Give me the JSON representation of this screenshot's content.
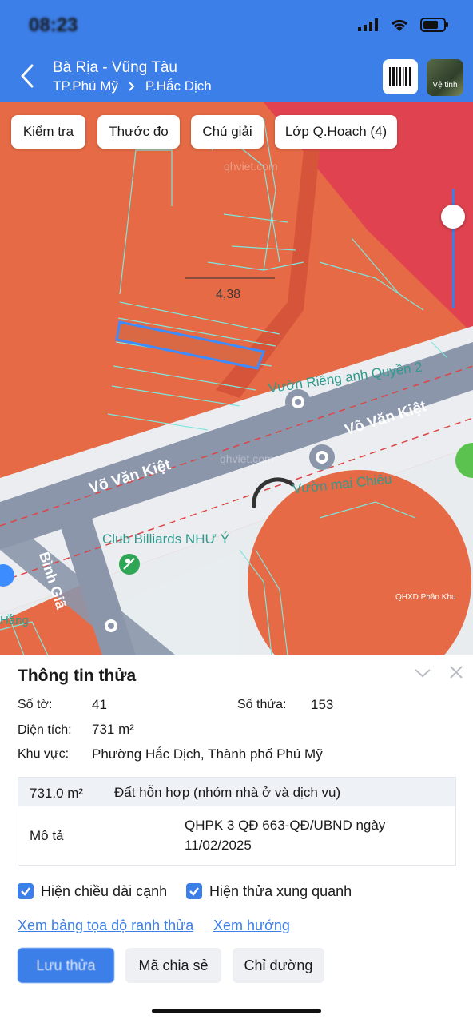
{
  "status_bar": {
    "time": "08:23"
  },
  "header": {
    "title": "Bà Rịa - Vũng Tàu",
    "breadcrumb": [
      "TP.Phú Mỹ",
      "P.Hắc Dịch"
    ],
    "satellite_label": "Vệ tinh"
  },
  "toolbar": {
    "check": "Kiểm tra",
    "measure": "Thước đo",
    "legend": "Chú giải",
    "layers": "Lớp Q.Hoạch (4)"
  },
  "map": {
    "dimension_label": "4,38",
    "road_name_1": "Võ Văn Kiệt",
    "road_name_2": "Võ Văn Kiệt",
    "road_name_3": "Bình Giã",
    "poi_1": "Vườn Riêng anh Quyền 2",
    "poi_2": "Vườn mai Chiêu",
    "poi_3": "Club Billiards NHƯ Ý",
    "poi_4": "Hằng",
    "watermark": "qhviet.com",
    "layer_tag": "QHXD Phân Khu"
  },
  "panel": {
    "title": "Thông tin thửa",
    "sheet_label": "Số tờ:",
    "sheet_value": "41",
    "plot_label": "Số thửa:",
    "plot_value": "153",
    "area_label": "Diện tích:",
    "area_value": "731 m²",
    "region_label": "Khu vực:",
    "region_value": "Phường Hắc Dịch, Thành phố Phú Mỹ",
    "table_area": "731.0 m²",
    "table_landuse": "Đất hỗn hợp (nhóm nhà ở và dịch vụ)",
    "table_desc_label": "Mô tả",
    "table_desc_value_1": "QHPK 3 QĐ 663-QĐ/UBND ngày",
    "table_desc_value_2": "11/02/2025",
    "check_1": "Hiện chiều dài cạnh",
    "check_2": "Hiện thửa xung quanh",
    "link_1": "Xem bảng tọa độ ranh thửa",
    "link_2": "Xem hướng",
    "btn_primary": "Lưu thửa",
    "btn_share": "Mã chia sẻ",
    "btn_directions": "Chỉ đường"
  },
  "colors": {
    "accent": "#3d7fe8",
    "zone_orange": "#e56a45",
    "zone_red": "#e0434f",
    "road_gray": "#8c96ab"
  }
}
